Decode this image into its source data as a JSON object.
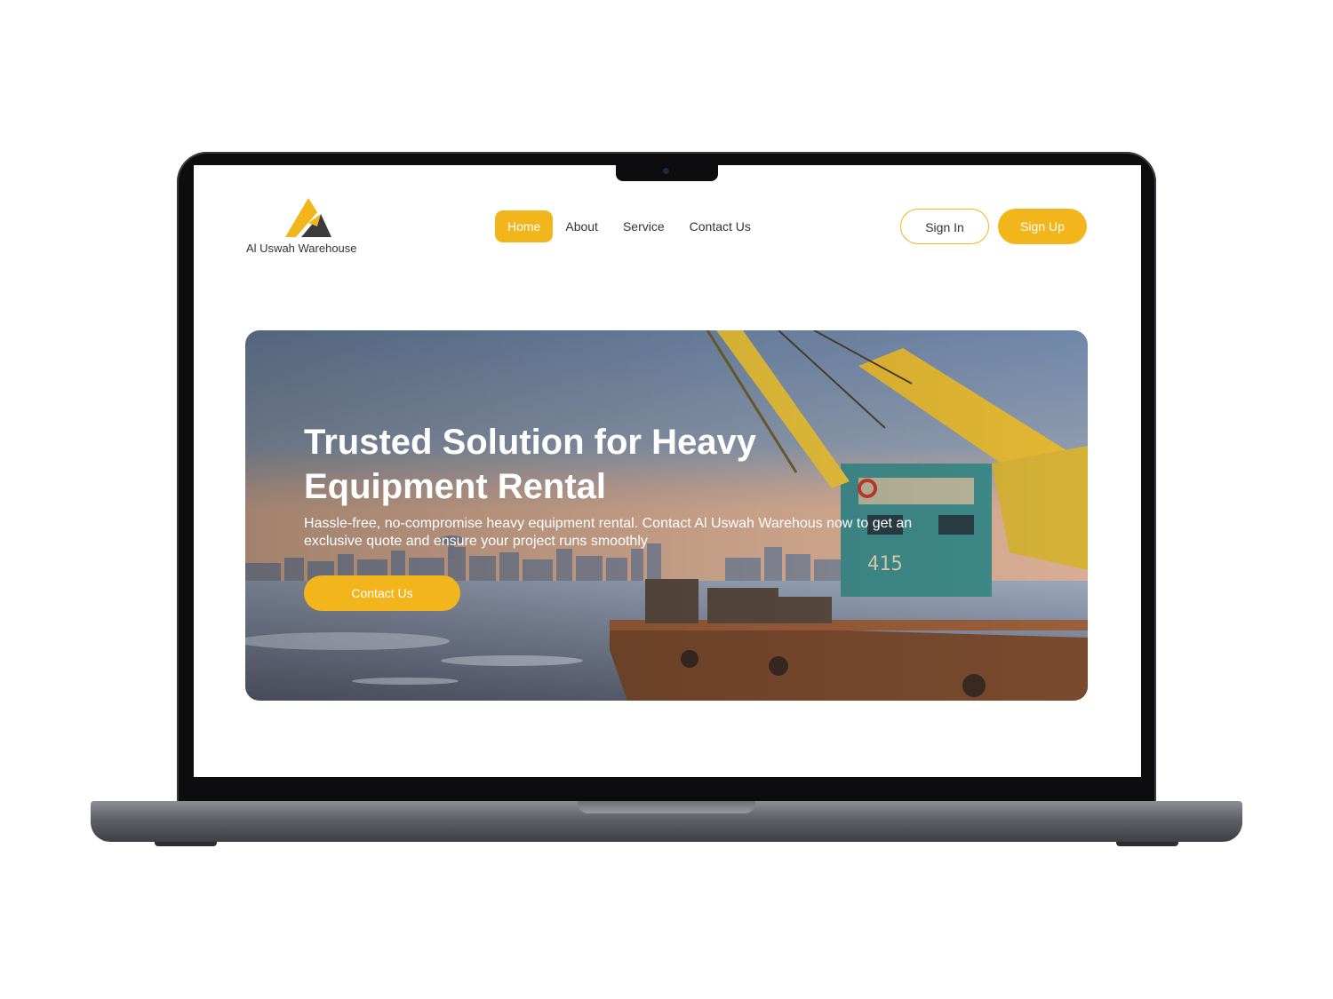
{
  "brand": {
    "name": "Al Uswah Warehouse",
    "accent_color": "#f2b51b",
    "dark_color": "#3b3b3b"
  },
  "nav": {
    "items": [
      {
        "label": "Home",
        "active": true
      },
      {
        "label": "About",
        "active": false
      },
      {
        "label": "Service",
        "active": false
      },
      {
        "label": "Contact Us",
        "active": false
      }
    ]
  },
  "auth": {
    "signin_label": "Sign In",
    "signup_label": "Sign Up"
  },
  "hero": {
    "title": "Trusted Solution for Heavy Equipment Rental",
    "subtitle": "Hassle-free, no-compromise heavy equipment rental. Contact Al Uswah Warehous now to get an exclusive quote and ensure your project runs smoothly",
    "cta_label": "Contact Us",
    "image_icon": "crane-barge-photo",
    "crane_number": "415"
  },
  "device": {
    "frame": "laptop-mockup"
  }
}
